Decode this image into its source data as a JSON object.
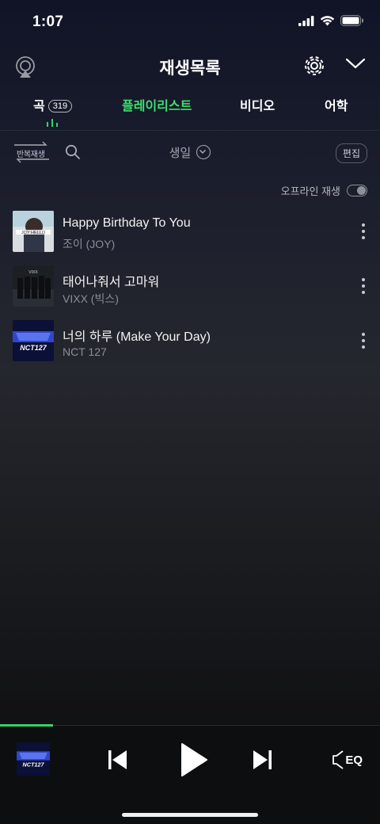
{
  "status": {
    "time": "1:07"
  },
  "header": {
    "title": "재생목록"
  },
  "tabs": [
    {
      "label": "곡",
      "count": "319"
    },
    {
      "label": "플레이리스트"
    },
    {
      "label": "비디오"
    },
    {
      "label": "어학"
    }
  ],
  "toolbar": {
    "repeat_label": "반복재생",
    "sort_label": "생일",
    "edit_label": "편집"
  },
  "offline": {
    "label": "오프라인 재생",
    "enabled": false
  },
  "songs": [
    {
      "title": "Happy Birthday To You",
      "artist": "조이 (JOY)",
      "art_text": "JOY HELLO"
    },
    {
      "title": "태어나줘서 고마워",
      "artist": "VIXX (빅스)",
      "art_text": "VIXX"
    },
    {
      "title": "너의 하루 (Make Your Day)",
      "artist": "NCT 127",
      "art_text": "NCT127"
    }
  ],
  "player": {
    "eq_label": "EQ",
    "progress": 0.14,
    "accent_color": "#35d36a"
  },
  "colors": {
    "active_tab": "#3be06e"
  }
}
